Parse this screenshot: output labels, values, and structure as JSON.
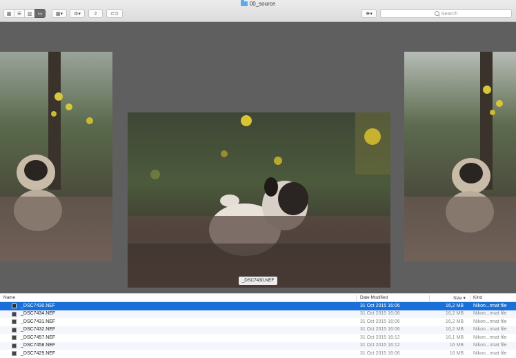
{
  "window": {
    "title": "00_source"
  },
  "toolbar": {
    "view_buttons": [
      "icon-view",
      "list-view",
      "column-view",
      "cover-flow-view"
    ],
    "arrange_label": "▾",
    "action_label": "▾",
    "dropbox_label": "▾",
    "search_placeholder": "Search"
  },
  "preview": {
    "caption": "_DSC7430.NEF"
  },
  "list": {
    "columns": {
      "name": "Name",
      "date": "Date Modified",
      "size": "Size",
      "kind": "Kind"
    },
    "rows": [
      {
        "name": "_DSC7430.NEF",
        "date": "31 Oct 2015 16:06",
        "size": "16,2 MB",
        "kind": "Nikon...rmat file",
        "selected": true
      },
      {
        "name": "_DSC7434.NEF",
        "date": "31 Oct 2015 16:06",
        "size": "16,2 MB",
        "kind": "Nikon...rmat file"
      },
      {
        "name": "_DSC7431.NEF",
        "date": "31 Oct 2015 16:06",
        "size": "16,2 MB",
        "kind": "Nikon...rmat file"
      },
      {
        "name": "_DSC7432.NEF",
        "date": "31 Oct 2015 16:06",
        "size": "16,2 MB",
        "kind": "Nikon...rmat file"
      },
      {
        "name": "_DSC7457.NEF",
        "date": "31 Oct 2015 16:12",
        "size": "16,1 MB",
        "kind": "Nikon...rmat file"
      },
      {
        "name": "_DSC7458.NEF",
        "date": "31 Oct 2015 16:12",
        "size": "16 MB",
        "kind": "Nikon...rmat file"
      },
      {
        "name": "_DSC7429.NEF",
        "date": "31 Oct 2015 16:06",
        "size": "16 MB",
        "kind": "Nikon...rmat file"
      }
    ]
  },
  "colors": {
    "selection": "#1b6fd8",
    "coverflow_bg": "#5f5f5f"
  }
}
